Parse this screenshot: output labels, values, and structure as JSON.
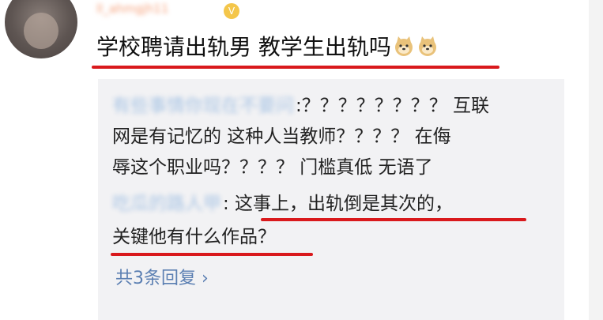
{
  "post": {
    "username": "ll_ahmgjh11",
    "main_text": "学校聘请出轨男 教学生出轨吗",
    "emoji": "doge-emoji"
  },
  "replies": [
    {
      "name": "​有些事情你现在不要问",
      "lines": [
        ":？？？？？？？？ 互联",
        "网是有记忆的 这种人当教师？？？？ 在侮",
        "辱这个职业吗？？？？ 门槛真低 无语了"
      ]
    },
    {
      "name": "吃瓜的路人甲",
      "lines": [
        ": 这事上，出轨倒是其次的，",
        "关键他有什么作品？"
      ]
    }
  ],
  "more_replies_label": "共3条回复 ›",
  "colors": {
    "underline": "#d9191c",
    "link": "#5b7fb2",
    "reply_bg": "#f2f2f4"
  }
}
